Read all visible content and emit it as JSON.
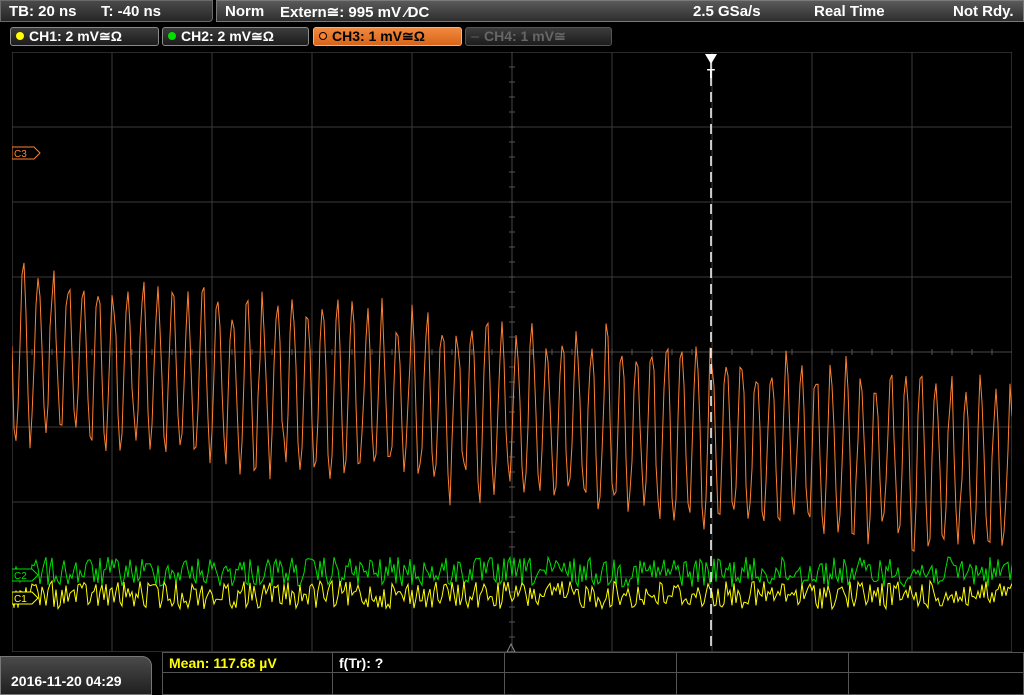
{
  "header": {
    "timebase": "TB: 20 ns",
    "trigger_time": "T: -40 ns",
    "mode": "Norm",
    "trigger_source": "Extern≅: 995 mV ⁄DC",
    "sample_rate": "2.5 GSa/s",
    "acq_mode": "Real Time",
    "status": "Not Rdy."
  },
  "channels": [
    {
      "label": "CH1: 2 mV≅Ω",
      "color": "#ffff00",
      "state": "on"
    },
    {
      "label": "CH2: 2 mV≅Ω",
      "color": "#00e000",
      "state": "on"
    },
    {
      "label": "CH3: 1 mV≅Ω",
      "color": "#ff8030",
      "state": "selected"
    },
    {
      "label": "CH4: 1 mV≅",
      "color": "#777777",
      "state": "off"
    }
  ],
  "screen": {
    "ch3_marker": "C3",
    "ch2_marker": "C2",
    "ch1_marker": "C1",
    "trigger_marker": "T"
  },
  "footer": {
    "datetime": "2016-11-20 04:29",
    "measurement_mean": "Mean: 117.68 µV",
    "measurement_freq": "f(Tr): ?"
  },
  "colors": {
    "ch1": "#ffff00",
    "ch2": "#00e000",
    "ch3": "#ff8030",
    "grid": "#3a3a3a",
    "mean_text": "#ffff00"
  }
}
